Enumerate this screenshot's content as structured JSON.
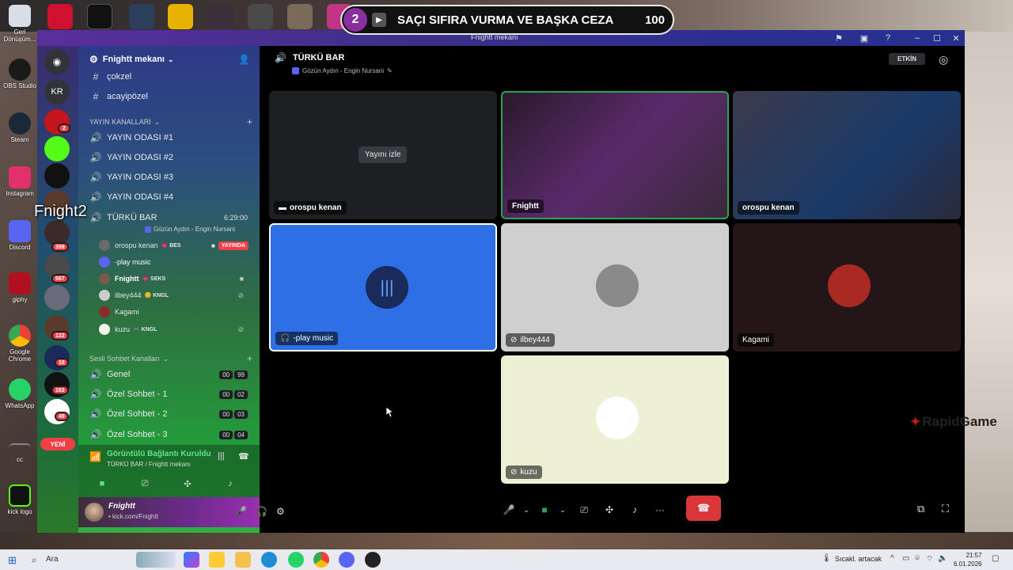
{
  "banner": {
    "number": "2",
    "title": "SAÇI SIFIRA VURMA VE BAŞKA CEZA",
    "score": "100"
  },
  "overlay_text": "Fnight2",
  "window": {
    "title": "Fnightt mekanı"
  },
  "server": {
    "name": "Fnightt mekanı"
  },
  "channels_top": [
    {
      "name": "çokzel",
      "icon": "hash-icon"
    },
    {
      "name": "acayipözel",
      "icon": "hash-icon"
    }
  ],
  "categories": {
    "stream": "YAYIN KANALLARI",
    "voice": "Sesli Sohbet Kanalları"
  },
  "stream_channels": [
    "YAYIN ODASI #1",
    "YAYIN ODASI #2",
    "YAYIN ODASI #3",
    "YAYIN ODASI #4"
  ],
  "active_channel": {
    "name": "TÜRKÜ BAR",
    "timer": "6:29:00",
    "status": "Gözün Aydın - Engin Nursani"
  },
  "members": [
    {
      "name": "orospu kenan",
      "tag": "💗 BES",
      "live": "YAYINDA"
    },
    {
      "name": "-play music",
      "tag": ""
    },
    {
      "name": "Fnightt",
      "tag": "💗 SEKS"
    },
    {
      "name": "ilbey444",
      "tag": "😊 KNGL"
    },
    {
      "name": "Kagami",
      "tag": ""
    },
    {
      "name": "kuzu",
      "tag": "🎮 KNGL"
    }
  ],
  "voice_channels": [
    {
      "name": "Genel",
      "a": "00",
      "b": "99"
    },
    {
      "name": "Özel Sohbet - 1",
      "a": "00",
      "b": "02"
    },
    {
      "name": "Özel Sohbet - 2",
      "a": "00",
      "b": "03"
    },
    {
      "name": "Özel Sohbet - 3",
      "a": "00",
      "b": "04"
    }
  ],
  "rail": {
    "home_label": "KR",
    "new_label": "YENİ",
    "badges": [
      "2",
      "399",
      "567",
      "122",
      "18",
      "163",
      "49"
    ]
  },
  "voice_panel": {
    "title": "Görüntülü Bağlantı Kuruldu",
    "subtitle": "TÜRKÜ BAR / Fnightt mekanı"
  },
  "user_panel": {
    "name": "Fnightt",
    "status": "• kick.com/Fnightt"
  },
  "stage": {
    "title": "TÜRKÜ BAR",
    "subtitle": "Gözün Aydın - Engin Nursani",
    "activity_button": "ETKİN",
    "watch_label": "Yayını izle",
    "tiles": [
      "orospu kenan",
      "Fnightt",
      "orospu kenan",
      "-play music",
      "ilbey444",
      "Kagami",
      "kuzu"
    ]
  },
  "desktop_icons": [
    "Geri Dönüşüm...",
    "OBS Studio",
    "Steam",
    "Instagram",
    "Discord",
    "giphy",
    "Google Chrome",
    "WhatsApp",
    "cc",
    "kick logo"
  ],
  "taskbar": {
    "search": "Ara",
    "weather": "Sıcakl. artacak",
    "time": "21:57",
    "date": "6.01.2026"
  },
  "brand_logo": "RapidGame",
  "colors": {
    "accent": "#5865f2",
    "danger": "#da373c",
    "online": "#23a55a"
  }
}
